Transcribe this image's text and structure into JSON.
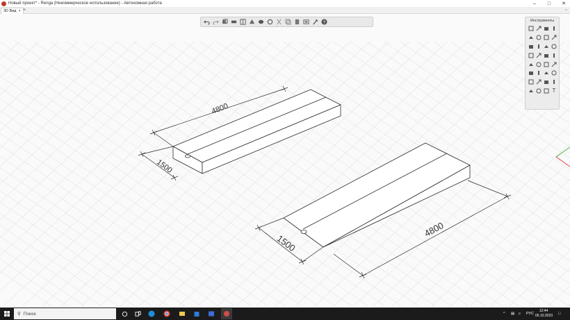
{
  "window": {
    "title": "Новый проект* - Renga (Некоммерческое использование) - Автономная работа",
    "controls": [
      "–",
      "□",
      "✕"
    ]
  },
  "tabs": [
    {
      "label": "3D Вид",
      "close": "×"
    }
  ],
  "tab_add": "+",
  "tab_overflow": "⌄",
  "toolbar": {
    "buttons": [
      "undo-icon",
      "redo-icon",
      "view-cube-icon",
      "layers-icon",
      "grid-icon",
      "section-icon",
      "visibility-icon",
      "snapshot-icon",
      "cut-icon",
      "copy-icon",
      "paste-icon",
      "display-mode-icon",
      "settings-icon",
      "help-icon"
    ]
  },
  "tools_panel": {
    "title": "Инструменты",
    "tools": [
      "select-icon",
      "level-icon",
      "wall-icon",
      "column-icon",
      "slab-icon",
      "roof-icon",
      "stair-icon",
      "beam-icon",
      "ramp-icon",
      "plate-icon",
      "window-icon",
      "door-icon",
      "railing-icon",
      "line-icon",
      "room-icon",
      "opening-icon",
      "pipe-icon",
      "equipment-icon",
      "duct-icon",
      "fitting-icon",
      "rebar-icon",
      "mesh-icon",
      "foundation-icon",
      "terminal-icon",
      "axis-icon",
      "element-icon",
      "assembly-icon",
      "trim-icon",
      "dimension-icon",
      "text-icon",
      "elevation-icon",
      "annotation-icon"
    ],
    "text_tool": "T"
  },
  "model": {
    "block1": {
      "length": "4800",
      "width": "1500"
    },
    "block2": {
      "length": "4800",
      "width": "1500"
    }
  },
  "taskbar": {
    "search_placeholder": "Поиск",
    "tray_lang": "РУС",
    "time": "12:44",
    "date": "05.10.2023",
    "tray_arrow": "^"
  },
  "colors": {
    "viewport_bg": "#fafafa",
    "grid": "#e4e4e4",
    "taskbar": "#1b1b1b",
    "axis_green": "#3cb043",
    "axis_red": "#e03030"
  }
}
